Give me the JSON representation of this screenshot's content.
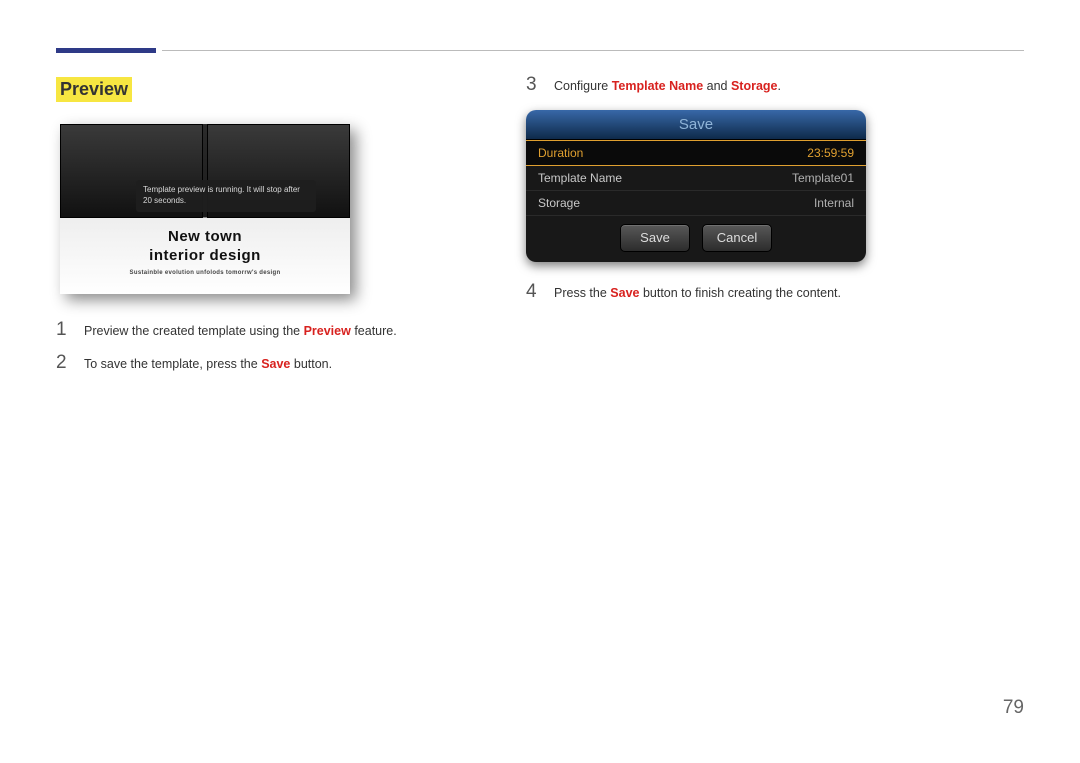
{
  "header": {
    "section_title": "Preview"
  },
  "preview_tile": {
    "tooltip": "Template preview is running. It will stop after 20 seconds.",
    "title_line1": "New town",
    "title_line2": "interior design",
    "subtitle": "Sustainble evolution unfolods tomorrw's design"
  },
  "steps_left": [
    {
      "n": "1",
      "pre": "Preview the created template using the ",
      "kw": "Preview",
      "post": " feature."
    },
    {
      "n": "2",
      "pre": "To save the template, press the ",
      "kw": "Save",
      "post": " button."
    }
  ],
  "steps_right": [
    {
      "n": "3",
      "pre": "Configure ",
      "kw": "Template Name",
      "mid": " and ",
      "kw2": "Storage",
      "post": "."
    },
    {
      "n": "4",
      "pre": "Press the ",
      "kw": "Save",
      "post": " button to finish creating the content."
    }
  ],
  "dialog": {
    "title": "Save",
    "rows": [
      {
        "label": "Duration",
        "value": "23:59:59",
        "highlight": true
      },
      {
        "label": "Template Name",
        "value": "Template01",
        "highlight": false
      },
      {
        "label": "Storage",
        "value": "Internal",
        "highlight": false
      }
    ],
    "save_label": "Save",
    "cancel_label": "Cancel"
  },
  "page_number": "79"
}
